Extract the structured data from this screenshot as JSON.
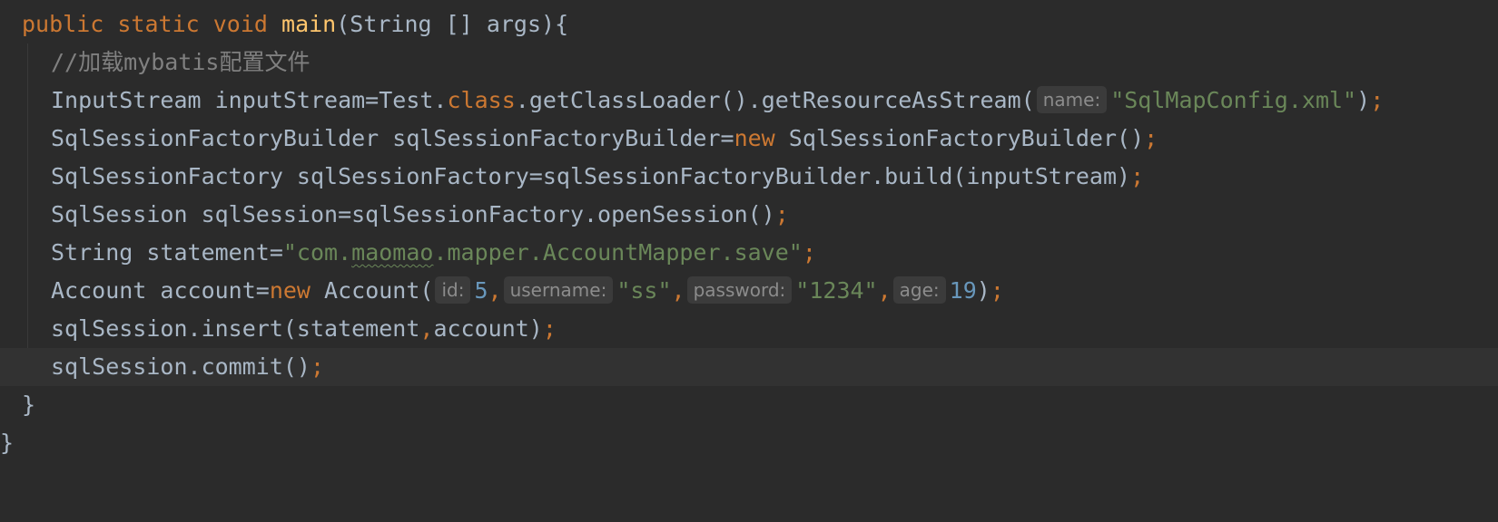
{
  "code": {
    "line0": {
      "public": "public",
      "static": "static",
      "void": "void",
      "main": "main",
      "rest": "(String [] args){"
    },
    "line1": {
      "comment": "//加载mybatis配置文件"
    },
    "line2": {
      "a": "InputStream inputStream=Test.",
      "class": "class",
      "b": ".getClassLoader().getResourceAsStream(",
      "hint": "name:",
      "str": "\"SqlMapConfig.xml\"",
      "c": ")",
      "semi": ";"
    },
    "line3": {
      "a": "SqlSessionFactoryBuilder sqlSessionFactoryBuilder=",
      "new": "new",
      "b": " SqlSessionFactoryBuilder()",
      "semi": ";"
    },
    "line4": {
      "a": "SqlSessionFactory sqlSessionFactory=sqlSessionFactoryBuilder.build(inputStream)",
      "semi": ";"
    },
    "line5": {
      "a": "SqlSession sqlSession=sqlSessionFactory.openSession()",
      "semi": ";"
    },
    "line6": {
      "a": "String statement=",
      "str1": "\"com.",
      "squig": "maomao",
      "str2": ".mapper.AccountMapper.save\"",
      "semi": ";"
    },
    "line7": {
      "a": "Account account=",
      "new": "new",
      "b": " Account(",
      "hint_id": "id:",
      "v_id": "5",
      "comma1": ",",
      "hint_username": "username:",
      "v_username": "\"ss\"",
      "comma2": ",",
      "hint_password": "password:",
      "v_password": "\"1234\"",
      "comma3": ",",
      "hint_age": "age:",
      "v_age": "19",
      "c": ")",
      "semi": ";"
    },
    "line8": {
      "a": "sqlSession.insert(statement",
      "comma": ",",
      "b": "account)",
      "semi": ";"
    },
    "line9": {
      "a": "sqlSession.commit()",
      "semi": ";"
    },
    "line10": {
      "brace": "}"
    },
    "line11": {
      "brace": "}"
    }
  },
  "colors": {
    "background": "#2b2b2b",
    "current_line": "#323232",
    "keyword": "#cc7832",
    "function": "#ffc66d",
    "string": "#6a8759",
    "number": "#6897bb",
    "comment": "#808080",
    "text": "#a9b7c6",
    "hint_bg": "#3b3b3b"
  }
}
